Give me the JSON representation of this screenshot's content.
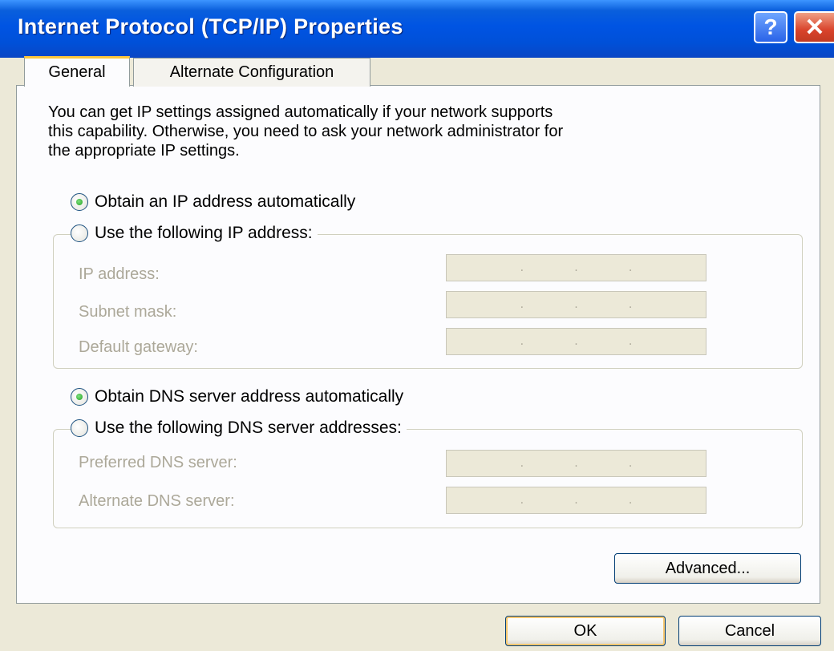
{
  "window": {
    "title": "Internet Protocol (TCP/IP) Properties",
    "help_glyph": "?",
    "close_glyph": "✕"
  },
  "tabs": [
    {
      "label": "General",
      "selected": true
    },
    {
      "label": "Alternate Configuration",
      "selected": false
    }
  ],
  "intro_text": "You can get IP settings assigned automatically if your network supports\nthis capability. Otherwise, you need to ask your network administrator for\nthe appropriate IP settings.",
  "ip": {
    "auto_label": "Obtain an IP address automatically",
    "auto_selected": true,
    "manual_label": "Use the following IP address:",
    "manual_selected": false,
    "fields": [
      {
        "label": "IP address:",
        "value": ""
      },
      {
        "label": "Subnet mask:",
        "value": ""
      },
      {
        "label": "Default gateway:",
        "value": ""
      }
    ]
  },
  "dns": {
    "auto_label": "Obtain DNS server address automatically",
    "auto_selected": true,
    "manual_label": "Use the following DNS server addresses:",
    "manual_selected": false,
    "fields": [
      {
        "label": "Preferred DNS server:",
        "value": ""
      },
      {
        "label": "Alternate DNS server:",
        "value": ""
      }
    ]
  },
  "buttons": {
    "advanced": "Advanced...",
    "ok": "OK",
    "cancel": "Cancel"
  },
  "colors": {
    "titlebar": "#0054e3",
    "dialog_bg": "#ece9d8",
    "disabled_text": "#aca899",
    "tab_highlight": "#ffc83c"
  }
}
